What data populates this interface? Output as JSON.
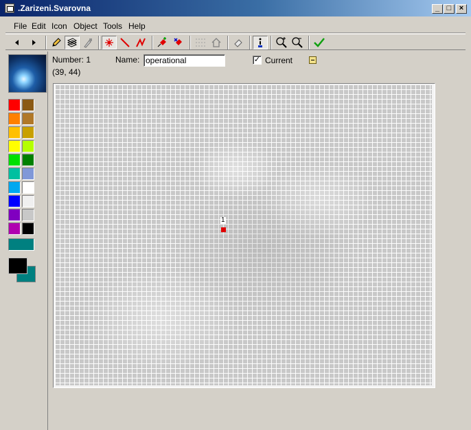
{
  "window": {
    "title": ".Zarizeni.Svarovna"
  },
  "menu": {
    "items": [
      "File",
      "Edit",
      "Icon",
      "Object",
      "Tools",
      "Help"
    ]
  },
  "toolbar": {
    "buttons": [
      {
        "name": "back-arrow-icon"
      },
      {
        "name": "forward-arrow-icon"
      },
      {
        "name": "pencil-icon"
      },
      {
        "name": "layers-icon"
      },
      {
        "name": "pipette-icon"
      },
      {
        "name": "point-icon"
      },
      {
        "name": "line-icon"
      },
      {
        "name": "polyline-icon"
      },
      {
        "name": "add-point-icon"
      },
      {
        "name": "remove-point-icon"
      },
      {
        "name": "group-icon"
      },
      {
        "name": "home-icon"
      },
      {
        "name": "eraser-icon"
      },
      {
        "name": "info-icon"
      },
      {
        "name": "zoom-in-icon"
      },
      {
        "name": "zoom-out-icon"
      },
      {
        "name": "confirm-check-icon"
      }
    ]
  },
  "info": {
    "number_label": "Number: 1",
    "coords": "(39, 44)",
    "name_label": "Name:",
    "name_value": "operational",
    "current_label": "Current",
    "current_checked": true
  },
  "palette": {
    "colors": [
      [
        "#ff0000",
        "#8b5a14"
      ],
      [
        "#ff8000",
        "#b07828"
      ],
      [
        "#ffc000",
        "#c8a000"
      ],
      [
        "#ffff00",
        "#b4ff00"
      ],
      [
        "#00e000",
        "#008000"
      ],
      [
        "#00c0a0",
        "#8098d8"
      ],
      [
        "#00a8f0",
        "#ffffff"
      ],
      [
        "#0000ff",
        "#f0f0f0"
      ],
      [
        "#8000c0",
        "#c8c8c8"
      ],
      [
        "#b000b0",
        "#000000"
      ]
    ],
    "wide_color": "#008080",
    "foreground": "#000000",
    "background": "#008080"
  },
  "canvas": {
    "point_label": "1",
    "point_color": "#e00000"
  }
}
